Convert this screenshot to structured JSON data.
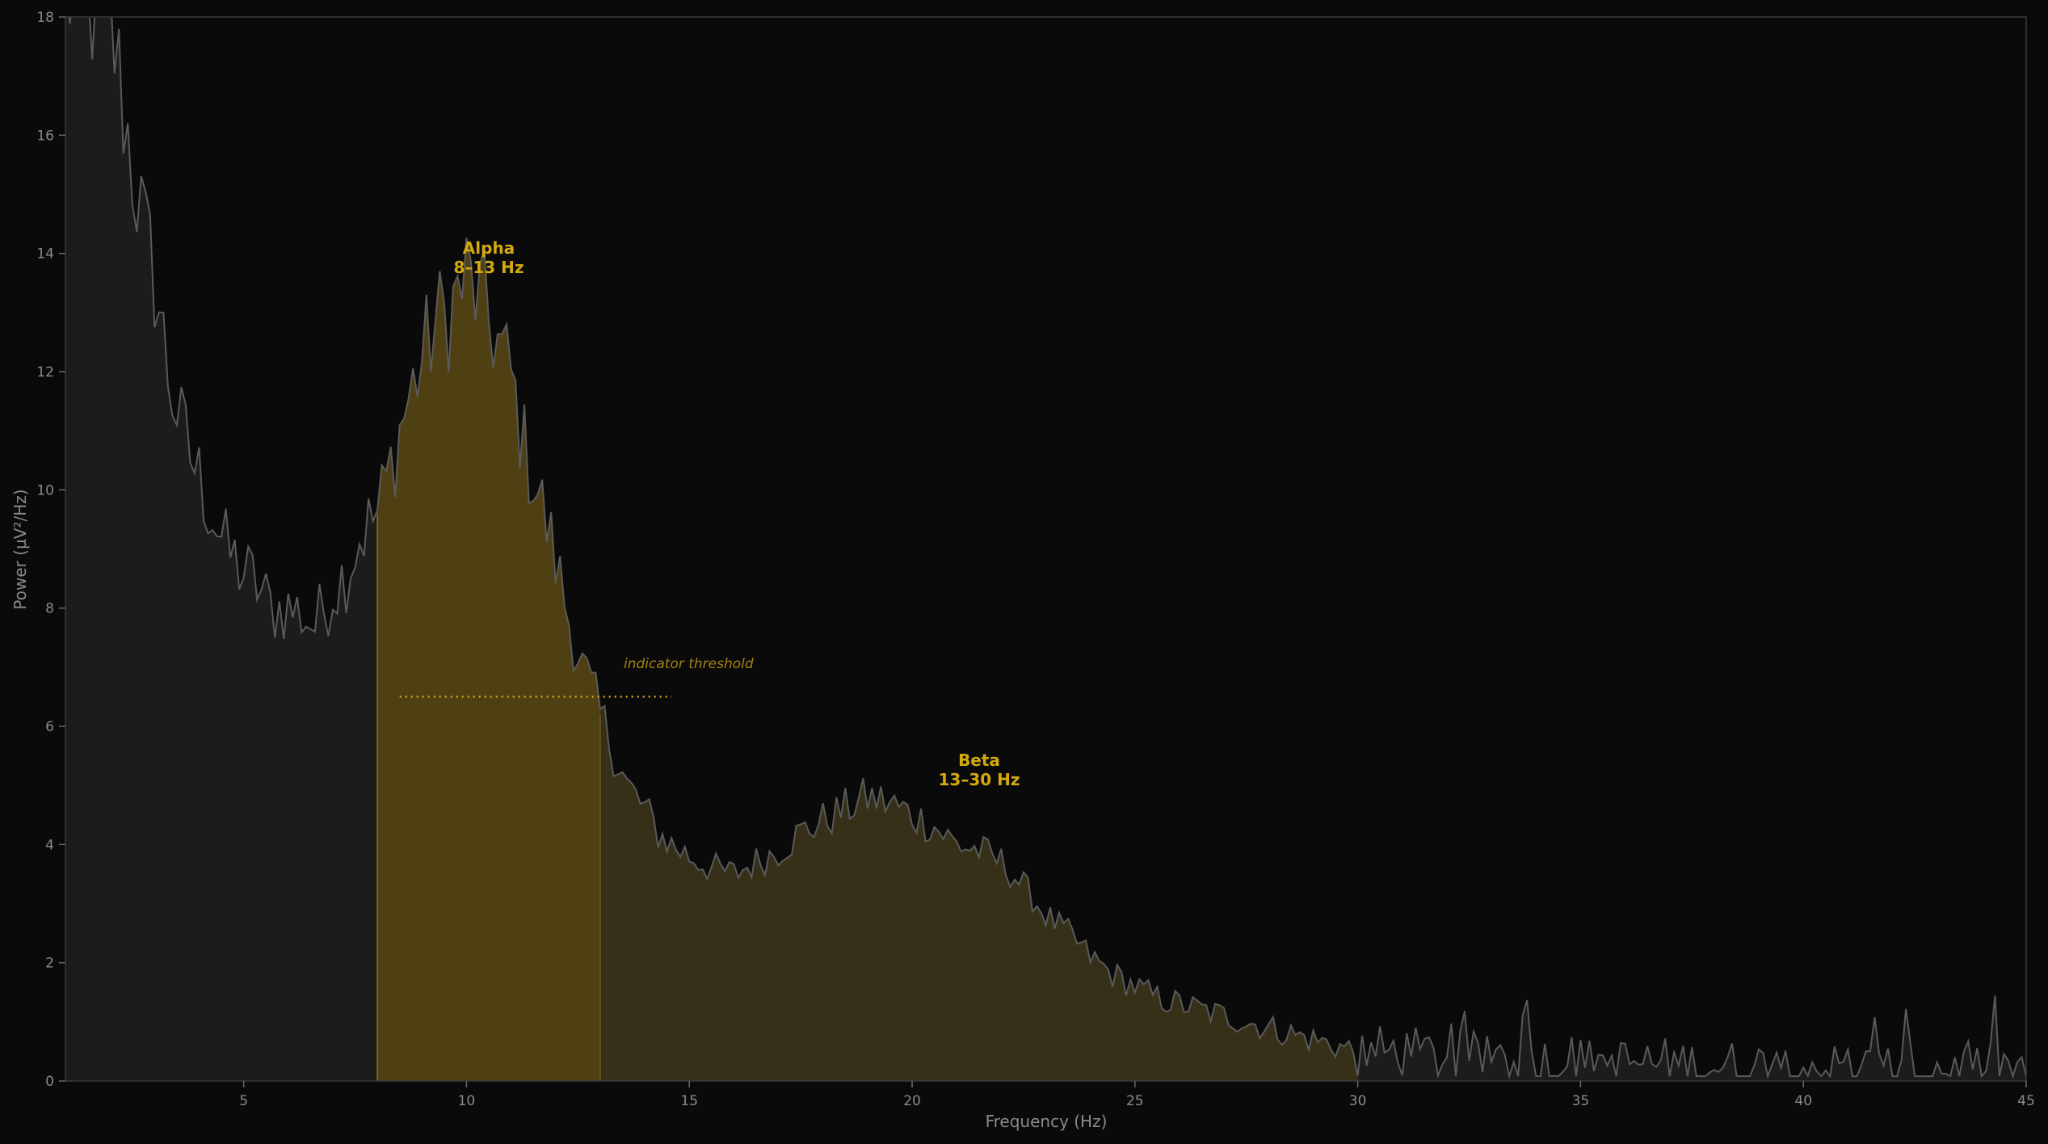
{
  "chart_data": {
    "type": "area",
    "title": "",
    "xlabel": "Frequency (Hz)",
    "ylabel": "Power (µV²/Hz)",
    "xlim": [
      1,
      45
    ],
    "ylim": [
      0,
      18
    ],
    "x_ticks": [
      "5",
      "10",
      "15",
      "20",
      "25",
      "30",
      "35",
      "40",
      "45"
    ],
    "y_ticks": [
      "0",
      "2",
      "4",
      "6",
      "8",
      "10",
      "12",
      "14",
      "16",
      "18"
    ],
    "grid": false,
    "colors": {
      "background": "#0a0a0a",
      "line": "#5a5a5a",
      "fill_base": "#1c1c1c",
      "alpha_fill": "#4f4014",
      "beta_fill": "#373019",
      "accent": "#d4a90e",
      "annotation": "#a48212"
    },
    "bands": [
      {
        "name": "Alpha",
        "label_line1": "Alpha",
        "label_line2": "8–13 Hz",
        "range": [
          8,
          13
        ],
        "label_x": 10.5,
        "label_y": 14
      }
    ],
    "bands2": [
      {
        "name": "Beta",
        "label_line1": "Beta",
        "label_line2": "13–30 Hz",
        "range": [
          13,
          30
        ],
        "label_x": 21.5,
        "label_y": 5.3
      }
    ],
    "threshold": {
      "value": 6.5,
      "x_range": [
        8.5,
        14.6
      ],
      "label": "indicator threshold",
      "label_x": 13.5,
      "label_y": 7.0
    },
    "series": [
      {
        "x": [
          1,
          1.5,
          2,
          2.2,
          2.5,
          2.8,
          3.0,
          3.3,
          3.6,
          4.0,
          4.3,
          4.6,
          5.0,
          5.3,
          5.6,
          6.0,
          6.3,
          6.6,
          7.0,
          7.3,
          7.6,
          8.0,
          8.3,
          8.6,
          9.0,
          9.3,
          9.6,
          10.0,
          10.3,
          10.6,
          11.0,
          11.3,
          11.6,
          12.0,
          12.3,
          12.6,
          13.0,
          13.3,
          13.6,
          14.0,
          14.3,
          14.6,
          15.0,
          15.5,
          16.0,
          16.5,
          17.0,
          17.5,
          18.0,
          18.5,
          19.0,
          19.5,
          20.0,
          20.5,
          21.0,
          21.5,
          22.0,
          22.5,
          23.0,
          23.5,
          24.0,
          24.5,
          25.0,
          25.5,
          26.0,
          26.5,
          27.0,
          27.5,
          28.0,
          28.5,
          29.0,
          29.5,
          30.0,
          31.0,
          32.0,
          33.0,
          34.0,
          35.0,
          36.0,
          37.0,
          38.0,
          39.0,
          40.0,
          41.0,
          42.0,
          43.0,
          44.0,
          45.0
        ],
        "values": [
          18.5,
          18.3,
          18.0,
          17.0,
          15.5,
          14.2,
          13.6,
          12.0,
          11.0,
          10.2,
          9.6,
          9.0,
          8.6,
          8.4,
          8.0,
          8.0,
          7.9,
          7.7,
          8.3,
          8.6,
          9.2,
          9.6,
          10.4,
          11.3,
          12.2,
          12.8,
          13.0,
          13.6,
          13.2,
          12.7,
          11.9,
          10.7,
          10.0,
          8.8,
          7.8,
          7.0,
          6.2,
          5.6,
          5.0,
          4.6,
          4.2,
          4.0,
          3.8,
          3.6,
          3.5,
          3.7,
          3.9,
          4.2,
          4.4,
          4.6,
          4.8,
          4.7,
          4.5,
          4.3,
          4.0,
          3.9,
          3.7,
          3.3,
          2.8,
          2.5,
          2.1,
          1.8,
          1.6,
          1.4,
          1.3,
          1.2,
          1.1,
          1.0,
          0.9,
          0.8,
          0.7,
          0.6,
          0.5,
          0.5,
          0.4,
          0.4,
          0.35,
          0.3,
          0.3,
          0.3,
          0.25,
          0.25,
          0.25,
          0.2,
          0.2,
          0.2,
          0.2,
          0.2
        ]
      }
    ]
  }
}
